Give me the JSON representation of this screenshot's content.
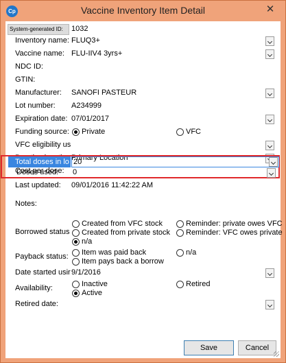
{
  "window": {
    "title": "Vaccine Inventory Item Detail",
    "close_glyph": "✕",
    "app_icon": "Cp"
  },
  "fields": {
    "system_id": {
      "label": "System-generated ID:",
      "value": "1032"
    },
    "inventory_name": {
      "label": "Inventory name:",
      "value": "FLUQ3+"
    },
    "vaccine_name": {
      "label": "Vaccine name:",
      "value": "FLU-IIV4 3yrs+"
    },
    "ndc_id": {
      "label": "NDC ID:",
      "value": ""
    },
    "gtin": {
      "label": "GTIN:",
      "value": ""
    },
    "manufacturer": {
      "label": "Manufacturer:",
      "value": "SANOFI  PASTEUR"
    },
    "lot_number": {
      "label": "Lot number:",
      "value": "A234999"
    },
    "expiration_date": {
      "label": "Expiration date:",
      "value": "07/01/2017"
    },
    "funding_source": {
      "label": "Funding source:",
      "options": [
        "Private",
        "VFC"
      ],
      "selected": "Private"
    },
    "vfc_eligibility": {
      "label": "VFC eligibility us",
      "value": ""
    },
    "practice_location": {
      "label": "Practice location",
      "value": "Primary Location"
    },
    "cost_per_dose": {
      "label": "Cost per dose:",
      "value": ""
    },
    "total_doses": {
      "label": "Total doses in lo",
      "value": "20"
    },
    "doses_used": {
      "label": "Doses used:",
      "value": "0"
    },
    "last_updated": {
      "label": "Last updated:",
      "value": "09/01/2016 11:42:22 AM"
    },
    "notes": {
      "label": "Notes:",
      "value": ""
    },
    "borrowed_status": {
      "label": "Borrowed status",
      "options": [
        "Created from VFC stock",
        "Reminder: private owes VFC",
        "Created from private stock",
        "Reminder: VFC owes private",
        "n/a"
      ],
      "selected": "n/a"
    },
    "payback_status": {
      "label": "Payback status:",
      "options": [
        "Item was paid back",
        "n/a",
        "Item pays back a borrow"
      ],
      "selected": ""
    },
    "date_started": {
      "label": "Date started usir",
      "value": "9/1/2016"
    },
    "availability": {
      "label": "Availability:",
      "options": [
        "Inactive",
        "Retired",
        "Active"
      ],
      "selected": "Active"
    },
    "retired_date": {
      "label": "Retired date:",
      "value": ""
    }
  },
  "buttons": {
    "save": "Save",
    "cancel": "Cancel"
  }
}
